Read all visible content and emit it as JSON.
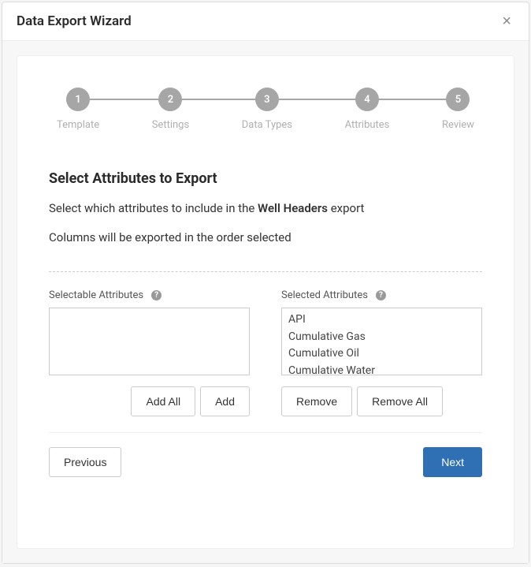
{
  "modal": {
    "title": "Data Export Wizard",
    "close_symbol": "×"
  },
  "stepper": {
    "steps": [
      {
        "num": "1",
        "label": "Template"
      },
      {
        "num": "2",
        "label": "Settings"
      },
      {
        "num": "3",
        "label": "Data Types"
      },
      {
        "num": "4",
        "label": "Attributes"
      },
      {
        "num": "5",
        "label": "Review"
      }
    ]
  },
  "section": {
    "title": "Select Attributes to Export",
    "desc_prefix": "Select which attributes to include in the ",
    "desc_bold": "Well Headers",
    "desc_suffix": " export",
    "desc2": "Columns will be exported in the order selected"
  },
  "selectable": {
    "label": "Selectable Attributes",
    "items": []
  },
  "selected": {
    "label": "Selected Attributes",
    "items": [
      "API",
      "Cumulative Gas",
      "Cumulative Oil",
      "Cumulative Water"
    ]
  },
  "buttons": {
    "add_all": "Add All",
    "add": "Add",
    "remove": "Remove",
    "remove_all": "Remove All",
    "previous": "Previous",
    "next": "Next"
  }
}
